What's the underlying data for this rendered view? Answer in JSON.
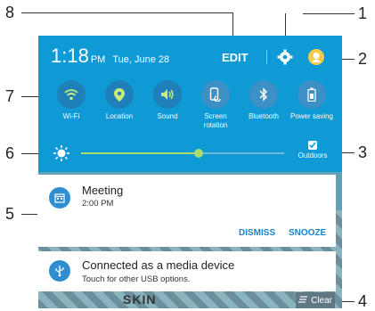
{
  "callouts": {
    "n1": "1",
    "n2": "2",
    "n3": "3",
    "n4": "4",
    "n5": "5",
    "n6": "6",
    "n7": "7",
    "n8": "8"
  },
  "status_bar": {
    "time": "1:18",
    "ampm": "PM",
    "date": "Tue, June 28",
    "edit_label": "EDIT"
  },
  "toggles": [
    {
      "label": "Wi-Fi",
      "icon": "wifi-icon",
      "active": true
    },
    {
      "label": "Location",
      "icon": "location-icon",
      "active": true
    },
    {
      "label": "Sound",
      "icon": "sound-icon",
      "active": true
    },
    {
      "label": "Screen rotation",
      "icon": "screen-rotation-icon",
      "active": false
    },
    {
      "label": "Bluetooth",
      "icon": "bluetooth-icon",
      "active": false
    },
    {
      "label": "Power saving",
      "icon": "power-saving-icon",
      "active": false
    }
  ],
  "brightness": {
    "level": 0.58,
    "outdoors_label": "Outdoors",
    "outdoors_checked": true
  },
  "notifications": [
    {
      "title": "Meeting",
      "subtitle": "2:00 PM",
      "actions": [
        "DISMISS",
        "SNOOZE"
      ],
      "icon": "calendar-icon"
    },
    {
      "title": "Connected as a media device",
      "subtitle": "Touch for other USB options.",
      "icon": "usb-icon"
    }
  ],
  "clear_label": "Clear",
  "wallpaper_text": "SKIN",
  "colors": {
    "shade": "#0f9ad6",
    "accent": "#1a83c9",
    "slider": "#a9dc6f"
  }
}
